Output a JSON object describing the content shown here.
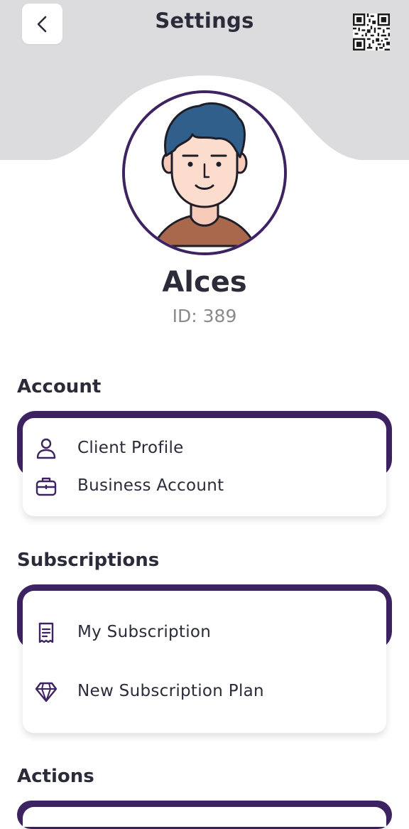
{
  "header": {
    "title": "Settings",
    "back_icon": "chevron-left-icon",
    "qr_icon": "qr-code-icon",
    "background_color": "#dcdcdf"
  },
  "profile": {
    "name": "Alces",
    "id_text": "ID: 389",
    "ring_color": "#3e2363"
  },
  "sections": {
    "account": {
      "title": "Account",
      "items": [
        {
          "label": "Client Profile",
          "icon": "user-icon"
        },
        {
          "label": "Business Account",
          "icon": "briefcase-icon"
        }
      ]
    },
    "subscriptions": {
      "title": "Subscriptions",
      "items": [
        {
          "label": "My Subscription",
          "icon": "receipt-icon"
        },
        {
          "label": "New Subscription Plan",
          "icon": "diamond-icon"
        }
      ]
    },
    "actions": {
      "title": "Actions"
    }
  },
  "theme": {
    "accent": "#3e2363",
    "text": "#2b2b3a",
    "muted": "#8a8a8a"
  }
}
